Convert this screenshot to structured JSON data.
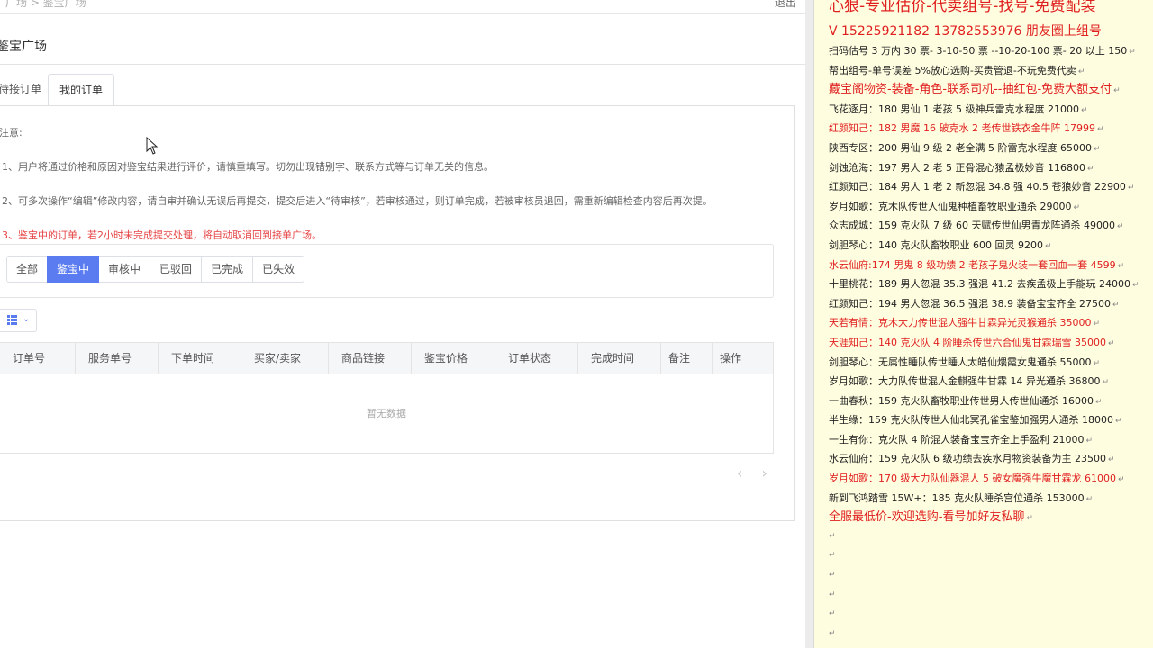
{
  "app": {
    "breadcrumb": "广场 > 鉴宝广场",
    "topbar_right": "退出",
    "page_title": "鉴宝广场",
    "tabs": [
      {
        "label": "待接订单"
      },
      {
        "label": "我的订单"
      }
    ],
    "notice": {
      "title": "注意:",
      "item1": "1、用户将通过价格和原因对鉴宝结果进行评价，请慎重填写。切勿出现错别字、联系方式等与订单无关的信息。",
      "item2": "2、可多次操作“编辑”修改内容，请自审并确认无误后再提交，提交后进入“待审核”，若审核通过，则订单完成，若被审核员退回，需重新编辑检查内容后再次提。",
      "item3": "3、鉴宝中的订单，若2小时未完成提交处理，将自动取消回到接单广场。"
    },
    "filters": [
      {
        "label": "全部",
        "active": false
      },
      {
        "label": "鉴宝中",
        "active": true
      },
      {
        "label": "审核中",
        "active": false
      },
      {
        "label": "已驳回",
        "active": false
      },
      {
        "label": "已完成",
        "active": false
      },
      {
        "label": "已失效",
        "active": false
      }
    ],
    "table": {
      "columns": [
        "订单号",
        "服务单号",
        "下单时间",
        "买家/卖家",
        "商品链接",
        "鉴宝价格",
        "订单状态",
        "完成时间",
        "备注",
        "操作"
      ],
      "empty_text": "暂无数据"
    },
    "pager": {
      "prev": "‹",
      "next": "›"
    }
  },
  "doc": {
    "header": "心狠-专业估价-代卖组号-找号-免费配装",
    "contact": "V 15225921182   13782553976 朋友圈上组号",
    "lines": [
      {
        "text": "扫码估号 3 万内 30 票- 3-10-50 票  --10-20-100 票- 20 以上 150",
        "red": false
      },
      {
        "text": "帮出组号-单号误差 5%放心选购-买贵管退-不玩免费代卖",
        "red": false
      },
      {
        "text": "藏宝阁物资-装备-角色-联系司机--抽红包-免费大额支付",
        "red": true,
        "big": true
      },
      {
        "text": "飞花逐月：180 男仙 1 老孩 5 级神兵雷克水程度 21000",
        "red": false
      },
      {
        "text": "红颜知己：182 男魔 16 破克水 2 老传世铁衣金牛阵 17999",
        "red": true
      },
      {
        "text": "陕西专区：200 男仙 9 级 2 老全满 5 阶雷克水程度 65000",
        "red": false
      },
      {
        "text": "剑蚀沧海：197 男人 2 老 5 正骨混心猿孟极妙音 116800",
        "red": false
      },
      {
        "text": "红颜知己：184 男人 1 老 2 新忽混 34.8 强 40.5 苍狼妙音 22900",
        "red": false
      },
      {
        "text": "岁月如歌：克木队传世人仙鬼种植畜牧职业通杀 29000",
        "red": false
      },
      {
        "text": "众志成城：159 克火队 7 级 60 天赋传世仙男青龙阵通杀 49000",
        "red": false
      },
      {
        "text": "剑胆琴心：140 克火队畜牧职业 600 回灵 9200",
        "red": false
      },
      {
        "text": "水云仙府:174 男鬼 8 级功绩 2 老孩子鬼火装一套回血一套 4599",
        "red": true
      },
      {
        "text": "十里桃花：189 男人忽混 35.3 强混 41.2 去疾孟极上手能玩 24000",
        "red": false
      },
      {
        "text": "红颜知己：194 男人忽混 36.5 强混 38.9 装备宝宝齐全 27500",
        "red": false
      },
      {
        "text": "天若有情：克木大力传世混人强牛甘霖异光灵猴通杀 35000",
        "red": true
      },
      {
        "text": "天涯知己：140 克火队 4 阶睡杀传世六合仙鬼甘霖瑞雪 35000",
        "red": true
      },
      {
        "text": "剑胆琴心：无属性睡队传世睡人太皓仙煨霞女鬼通杀 55000",
        "red": false
      },
      {
        "text": "岁月如歌：大力队传世混人金麒强牛甘霖 14 异光通杀 36800",
        "red": false
      },
      {
        "text": "一曲春秋：159 克火队畜牧职业传世男人传世仙通杀 16000",
        "red": false
      },
      {
        "text": "半生缘：159 克火队传世人仙北冥孔雀宝鉴加强男人通杀 18000",
        "red": false
      },
      {
        "text": "一生有你：克火队 4 阶混人装备宝宝齐全上手盈利 21000",
        "red": false
      },
      {
        "text": "水云仙府：159 克火队 6 级功绩去疾水月物资装备为主 23500",
        "red": false
      },
      {
        "text": "岁月如歌：170 级大力队仙器混人 5 破女魔强牛魔甘霖龙 61000",
        "red": true
      },
      {
        "text": "新到飞鸿踏雪 15W+：185 克火队睡杀宫位通杀 153000",
        "red": false
      },
      {
        "text": "全服最低价-欢迎选购-看号加好友私聊",
        "red": true,
        "big": true
      }
    ],
    "paragraph_mark": "↵"
  }
}
